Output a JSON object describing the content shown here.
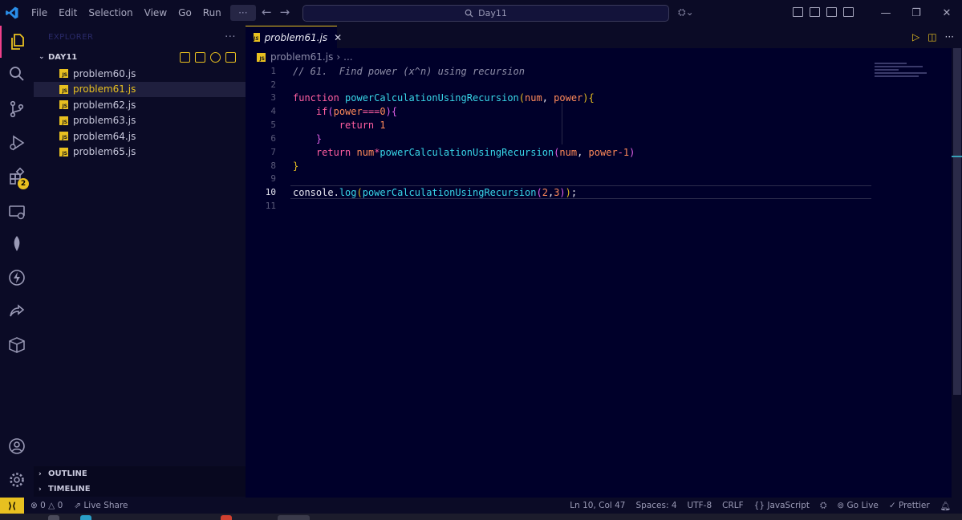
{
  "titlebar": {
    "menu": [
      "File",
      "Edit",
      "Selection",
      "View",
      "Go",
      "Run"
    ],
    "more": "···",
    "search": "Day11",
    "back": "←",
    "forward": "→"
  },
  "activity": {
    "extensions_badge": "2"
  },
  "sidebar": {
    "header": "EXPLORER",
    "more": "···",
    "folder": "DAY11",
    "files": [
      "problem60.js",
      "problem61.js",
      "problem62.js",
      "problem63.js",
      "problem64.js",
      "problem65.js"
    ],
    "selected": "problem61.js",
    "outline": "OUTLINE",
    "timeline": "TIMELINE"
  },
  "tab": {
    "label": "problem61.js",
    "close": "✕"
  },
  "breadcrumb": {
    "file": "problem61.js",
    "sep": "›",
    "rest": "..."
  },
  "code": {
    "line_numbers": [
      "1",
      "2",
      "3",
      "4",
      "5",
      "6",
      "7",
      "8",
      "9",
      "10",
      "11"
    ],
    "current_line": "10",
    "l1": "// 61.  Find power (x^n) using recursion",
    "kw_function": "function",
    "fn_name": "powerCalculationUsingRecursion",
    "p_num": "num",
    "p_power": "power",
    "kw_if": "if",
    "cond_var": "power",
    "op_eq": "===",
    "zero": "0",
    "kw_return": "return",
    "one": "1",
    "ret_num": "num",
    "op_mul": "*",
    "ret_power": "power",
    "op_minus": "-",
    "console": "console",
    "log": "log",
    "arg2": "2",
    "arg3": "3"
  },
  "statusbar": {
    "errors": "0",
    "warnings": "0",
    "liveshare": "Live Share",
    "position": "Ln 10, Col 47",
    "spaces": "Spaces: 4",
    "encoding": "UTF-8",
    "eol": "CRLF",
    "language": "JavaScript",
    "golive": "Go Live",
    "prettier": "Prettier"
  },
  "colors": {
    "accent": "#e8c020",
    "keyword": "#ff5ea0",
    "function": "#38d6e8",
    "background": "#00002a"
  }
}
